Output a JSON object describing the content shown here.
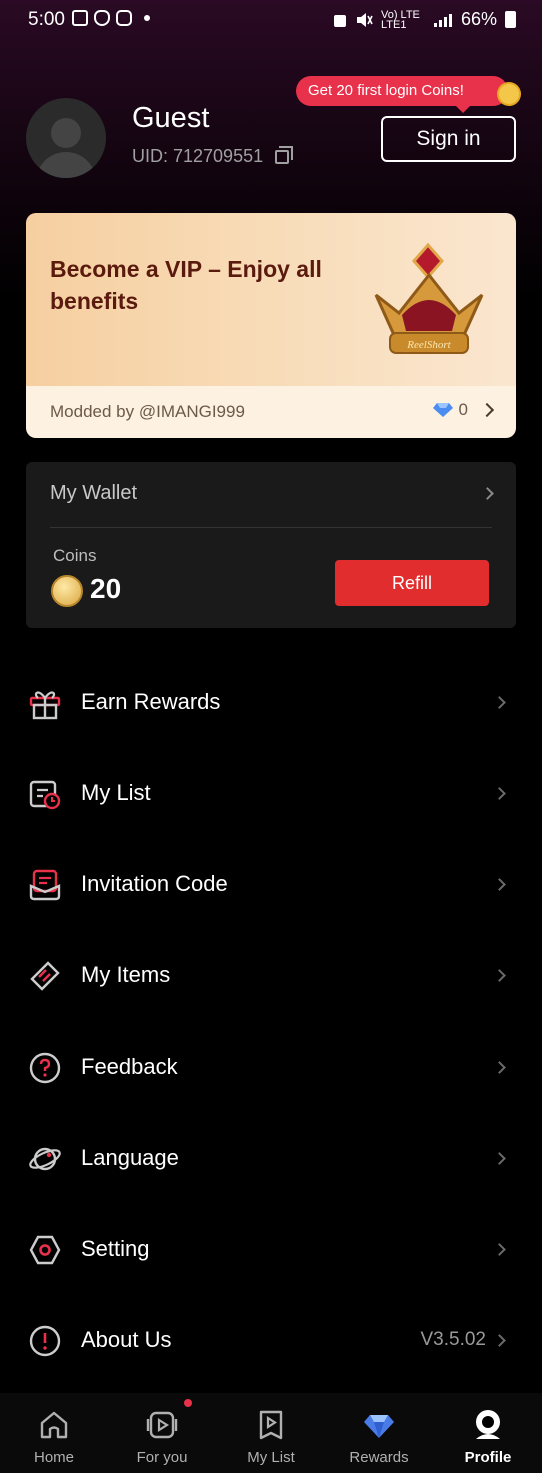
{
  "status_bar": {
    "time": "5:00",
    "network": "Vo) LTE LTE1",
    "battery": "66%"
  },
  "profile": {
    "name": "Guest",
    "uid": "UID: 712709551",
    "promo": "Get 20 first login Coins!",
    "sign_in": "Sign in"
  },
  "vip": {
    "title": "Become a VIP – Enjoy all benefits",
    "modded_by": "Modded by @IMANGI999",
    "gems": "0",
    "crown_text": "ReelShort"
  },
  "wallet": {
    "title": "My Wallet",
    "coins_label": "Coins",
    "coins_value": "20",
    "refill": "Refill"
  },
  "menu": [
    {
      "label": "Earn Rewards",
      "icon": "gift-icon"
    },
    {
      "label": "My List",
      "icon": "calendar-clock-icon"
    },
    {
      "label": "Invitation Code",
      "icon": "invite-icon"
    },
    {
      "label": "My Items",
      "icon": "ticket-icon"
    },
    {
      "label": "Feedback",
      "icon": "question-icon"
    },
    {
      "label": "Language",
      "icon": "planet-icon"
    },
    {
      "label": "Setting",
      "icon": "settings-icon"
    },
    {
      "label": "About Us",
      "icon": "info-icon",
      "version": "V3.5.02"
    }
  ],
  "nav": [
    {
      "label": "Home",
      "icon": "home-icon"
    },
    {
      "label": "For you",
      "icon": "play-screen-icon"
    },
    {
      "label": "My List",
      "icon": "bookmark-play-icon"
    },
    {
      "label": "Rewards",
      "icon": "diamond-icon"
    },
    {
      "label": "Profile",
      "icon": "profile-icon",
      "active": true
    }
  ],
  "colors": {
    "accent_red": "#e12d2d",
    "promo_pink": "#e8314b",
    "vip_text": "#5a1a0e",
    "card_bg": "#1a1a1a"
  }
}
